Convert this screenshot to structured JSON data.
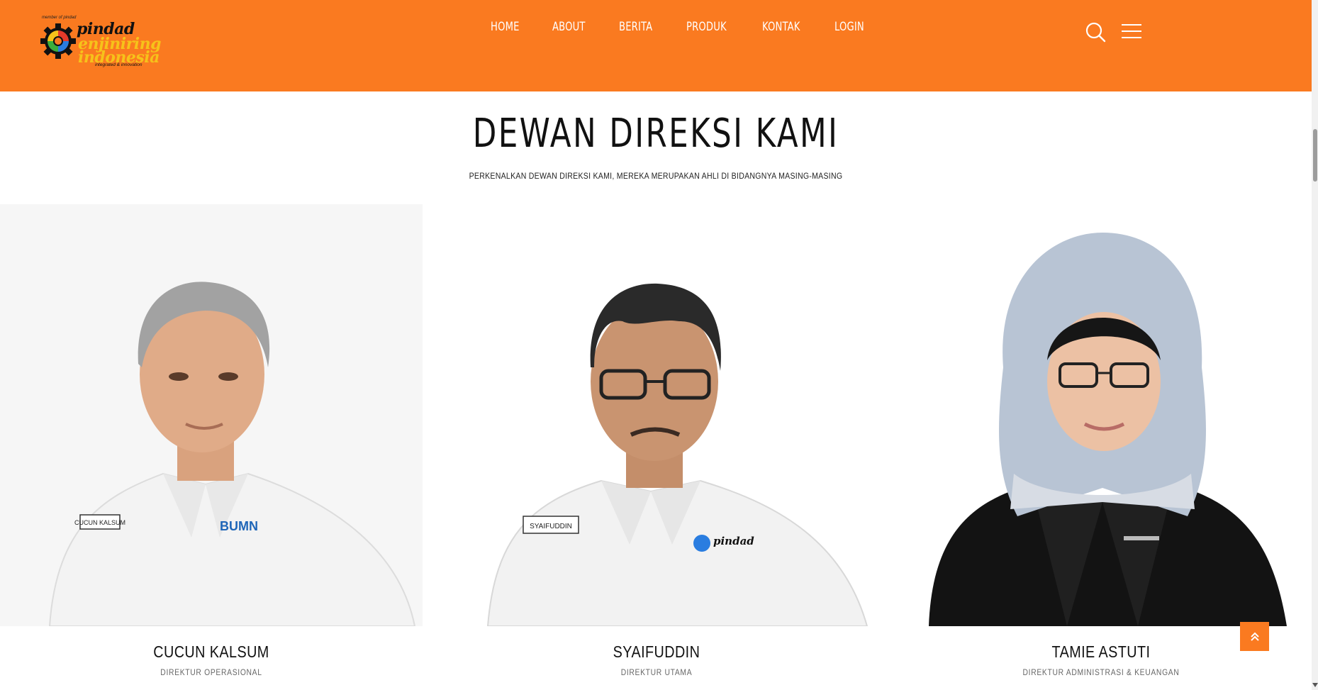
{
  "header": {
    "logo": {
      "pre_text": "member of pindad",
      "line1": "pindad",
      "line2": "enjiniring",
      "line3": "indonesia",
      "tagline": "integrated & innovation"
    },
    "nav": [
      "HOME",
      "ABOUT",
      "BERITA",
      "PRODUK",
      "KONTAK",
      "LOGIN"
    ],
    "accent_color": "#fa7a20"
  },
  "section": {
    "title": "DEWAN DIREKSI KAMI",
    "subtitle": "PERKENALKAN DEWAN DIREKSI KAMI, MEREKA MERUPAKAN AHLI DI BIDANGNYA MASING-MASING"
  },
  "directors": [
    {
      "name": "CUCUN KALSUM",
      "role": "DIREKTUR OPERASIONAL",
      "badge": "CUCUN KALSUM"
    },
    {
      "name": "SYAIFUDDIN",
      "role": "DIREKTUR UTAMA",
      "badge": "SYAIFUDDIN"
    },
    {
      "name": "TAMIE ASTUTI",
      "role": "DIREKTUR ADMINISTRASI & KEUANGAN",
      "badge": ""
    }
  ],
  "icons": {
    "search": "search-icon",
    "menu": "hamburger-menu-icon",
    "back_to_top": "double-chevron-up-icon"
  }
}
